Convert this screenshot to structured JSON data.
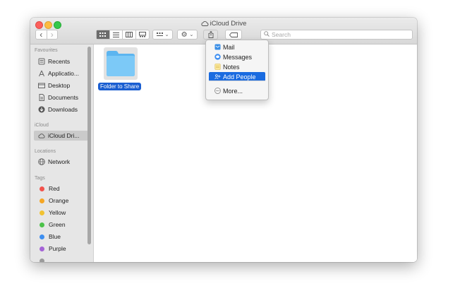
{
  "window": {
    "title": "iCloud Drive"
  },
  "toolbar": {
    "nav": {
      "back": "‹",
      "forward": "›"
    },
    "search": {
      "placeholder": "Search"
    }
  },
  "sidebar": {
    "sections": [
      {
        "label": "Favourites",
        "items": [
          "Recents",
          "Applicatio...",
          "Desktop",
          "Documents",
          "Downloads"
        ]
      },
      {
        "label": "iCloud",
        "items": [
          "iCloud Dri..."
        ]
      },
      {
        "label": "Locations",
        "items": [
          "Network"
        ]
      },
      {
        "label": "Tags",
        "items": [
          "Red",
          "Orange",
          "Yellow",
          "Green",
          "Blue",
          "Purple"
        ]
      }
    ],
    "selected": "iCloud Dri...",
    "tag_colors": {
      "Red": "#f2524c",
      "Orange": "#f5a623",
      "Yellow": "#f1c232",
      "Green": "#4cc24a",
      "Blue": "#3d8ef0",
      "Purple": "#a463d6"
    }
  },
  "main": {
    "items": [
      {
        "name": "Folder to Share",
        "icon": "folder-icon",
        "selected": true
      }
    ]
  },
  "share_menu": {
    "items": [
      {
        "label": "Mail",
        "icon": "mail-icon"
      },
      {
        "label": "Messages",
        "icon": "messages-icon"
      },
      {
        "label": "Notes",
        "icon": "notes-icon"
      },
      {
        "label": "Add People",
        "icon": "add-people-icon",
        "highlighted": true
      },
      {
        "label": "More...",
        "icon": "more-icon"
      }
    ]
  },
  "colors": {
    "accent": "#1a6be0",
    "selection": "#1a5ed1",
    "folder": "#6dc0f5"
  }
}
